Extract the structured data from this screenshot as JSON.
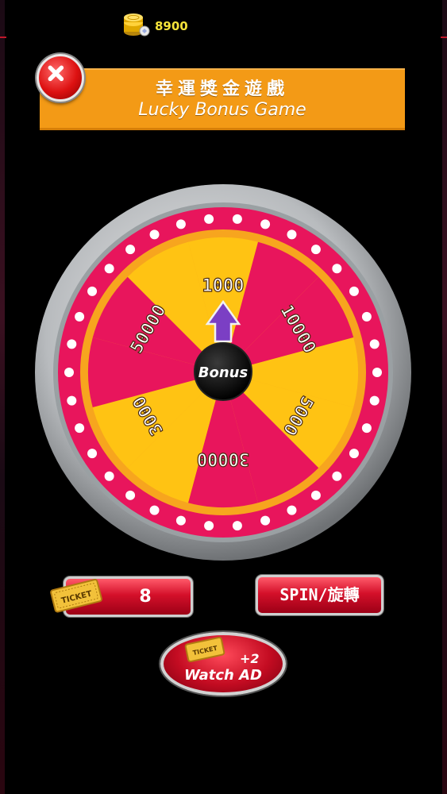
{
  "top_bar": {
    "coin_amount": "8900",
    "coin_icon": "coin-stack-icon"
  },
  "header": {
    "title_zh": "幸運獎金遊戲",
    "title_en": "Lucky Bonus Game",
    "close_icon": "close-icon"
  },
  "wheel": {
    "center_label": "Bonus",
    "pointer_icon": "up-arrow-icon",
    "segments": [
      "1000",
      "10000",
      "5000",
      "30000",
      "3000",
      "50000"
    ],
    "colors": {
      "rim": "#e8155c",
      "segment_pink": "#e8155c",
      "segment_yellow": "#ffc313",
      "bezel": "#b9bcbf",
      "pointer": "#7b3fc4"
    }
  },
  "controls": {
    "ticket_label": "TICKET",
    "ticket_count": "8",
    "spin_label": "SPIN/旋轉",
    "watch_ad_bonus": "+2",
    "watch_ad_label": "Watch AD",
    "ad_ticket_label": "TICKET"
  },
  "colors": {
    "header_orange": "#f39a16",
    "button_red": "#d4102a",
    "coin_text": "#f5e33a"
  }
}
